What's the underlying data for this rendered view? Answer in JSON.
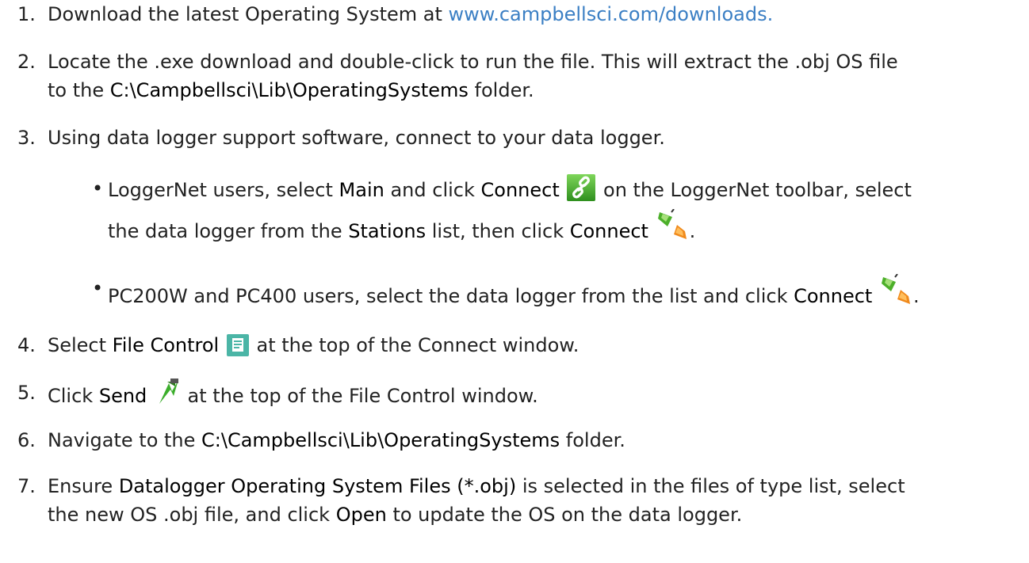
{
  "steps": [
    {
      "num": "1.",
      "t1": "Download the latest Operating System at ",
      "link": "www.campbellsci.com/downloads."
    },
    {
      "num": "2.",
      "t1": "Locate the .exe download and double-click to run the file. This will extract the .obj OS file",
      "t2": "to the ",
      "b1": "C:\\Campbellsci\\Lib\\OperatingSystems",
      "t3": " folder."
    },
    {
      "num": "3.",
      "t1": "Using data logger support software, connect to your data logger."
    },
    {
      "num": "4.",
      "t1": "Select ",
      "b1": "File Control",
      "t2": " at the top of the Connect window."
    },
    {
      "num": "5.",
      "t1": "Click ",
      "b1": "Send",
      "t2": " at the top of the File Control window."
    },
    {
      "num": "6.",
      "t1": "Navigate to the ",
      "b1": "C:\\Campbellsci\\Lib\\OperatingSystems",
      "t2": " folder."
    },
    {
      "num": "7.",
      "t1": "Ensure ",
      "b1": "Datalogger Operating System Files (*.obj)",
      "t2": " is selected in the files of type list, select",
      "t3": "the new OS .obj file, and click ",
      "b2": "Open",
      "t4": " to update the OS on the data logger."
    }
  ],
  "bullets": [
    {
      "t1": "LoggerNet users, select ",
      "b1": "Main",
      "t2": " and click ",
      "b2": "Connect",
      "t3": " on the LoggerNet toolbar, select",
      "t4": "the data logger from the ",
      "b3": "Stations",
      "t5": " list, then click ",
      "b4": "Connect",
      "t6": "."
    },
    {
      "t1": "PC200W and PC400 users, select the data logger from the list and click ",
      "b1": "Connect",
      "t2": "."
    }
  ],
  "icons": {
    "connect_toolbar": "link-chain-icon",
    "connect_plug": "plug-connect-icon",
    "file_control": "file-control-icon",
    "send": "send-arrow-icon"
  },
  "colors": {
    "link": "#3b7fc4",
    "text": "#222222"
  }
}
